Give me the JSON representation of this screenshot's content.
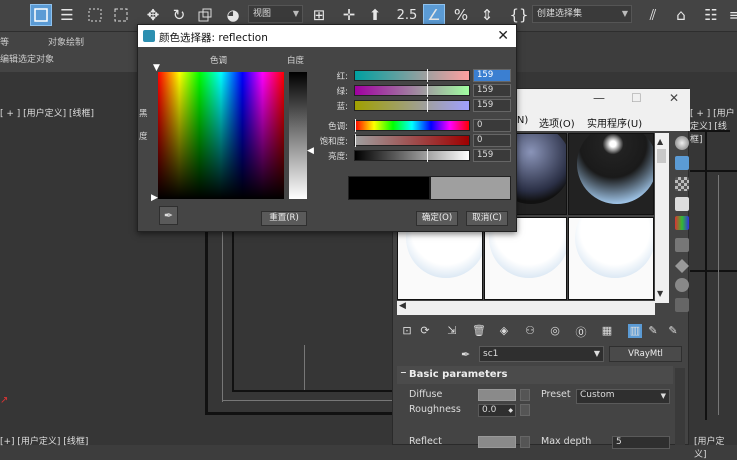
{
  "toolbar": {
    "view_dropdown": "视图",
    "selection_set_placeholder": "创建选择集",
    "snap_value": "2.5"
  },
  "ribbon": {
    "tab_left": "等",
    "tab_object_paint": "对象绘制",
    "tab_edit_selected": "编辑选定对象"
  },
  "viewport": {
    "label_top_left": "[ + ] [用户定义] [线框]",
    "label_top_right": "[ + ] [用户定义] [线框]",
    "label_bottom_left": "[+] [用户定义] [线框]",
    "label_bottom_right": "[用户定义]"
  },
  "color_picker": {
    "title": "颜色选择器: reflection",
    "hue_header": "色调",
    "whiteness_header": "白度",
    "black_label": "黑",
    "degree_label": "度",
    "rows": [
      {
        "label": "红:",
        "value": "159"
      },
      {
        "label": "绿:",
        "value": "159"
      },
      {
        "label": "蓝:",
        "value": "159"
      },
      {
        "label": "色调:",
        "value": "0"
      },
      {
        "label": "饱和度:",
        "value": "0"
      },
      {
        "label": "亮度:",
        "value": "159"
      }
    ],
    "reset_button": "重置(R)",
    "ok_button": "确定(O)",
    "cancel_button": "取消(C)",
    "current_color": "#000000",
    "new_color": "#9f9f9f"
  },
  "material_editor": {
    "menus": [
      "(N)",
      "选项(O)",
      "实用程序(U)"
    ],
    "material_name": "sc1",
    "material_type": "VRayMtl",
    "rollout_title": "Basic parameters",
    "params": {
      "diffuse_label": "Diffuse",
      "preset_label": "Preset",
      "preset_value": "Custom",
      "roughness_label": "Roughness",
      "roughness_value": "0.0",
      "reflect_label": "Reflect",
      "max_depth_label": "Max depth",
      "max_depth_value": "5"
    }
  },
  "colors": {
    "accent": "#5b9bd5",
    "dialog_bg": "#454545",
    "app_bg": "#3d3d3d"
  }
}
